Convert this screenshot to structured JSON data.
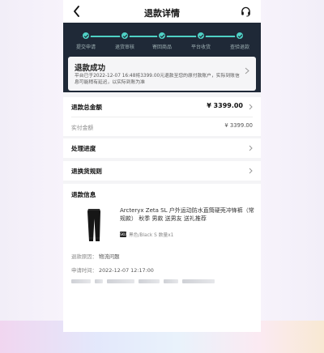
{
  "header": {
    "title": "退款详情"
  },
  "steps": [
    {
      "label": "提交申请"
    },
    {
      "label": "退货审核"
    },
    {
      "label": "寄回商品"
    },
    {
      "label": "平台收货"
    },
    {
      "label": "查验退款"
    }
  ],
  "status": {
    "title": "退款成功",
    "description": "平台已于2022-12-07 16:48将3399.00元退款至您的原付款账户，实际到账信息可能稍有延迟，以实际到账为准"
  },
  "refund_summary": {
    "total_label": "退款总金额",
    "total_value": "¥ 3399.00",
    "actual_label": "实付金额",
    "actual_value": "¥ 3399.00"
  },
  "progress_row": {
    "label": "处理进度"
  },
  "rules_row": {
    "label": "退换货规则"
  },
  "refund_info": {
    "title": "退款信息",
    "product_name": "Arcteryx Zeta SL 户外运动防水直筒硬壳冲锋裤（常规款） 秋季 男款 送男友 送礼推荐",
    "sku_tag": "SKU",
    "sku": "黑色/Black S 数量x1",
    "reason_label": "退款原因：",
    "reason_value": "物流问题",
    "time_label": "申请时间：",
    "time_value": "2022-12-07 12:17:00"
  },
  "colors": {
    "accent": "#4fd1c5",
    "dark_panel": "#1f2937"
  }
}
